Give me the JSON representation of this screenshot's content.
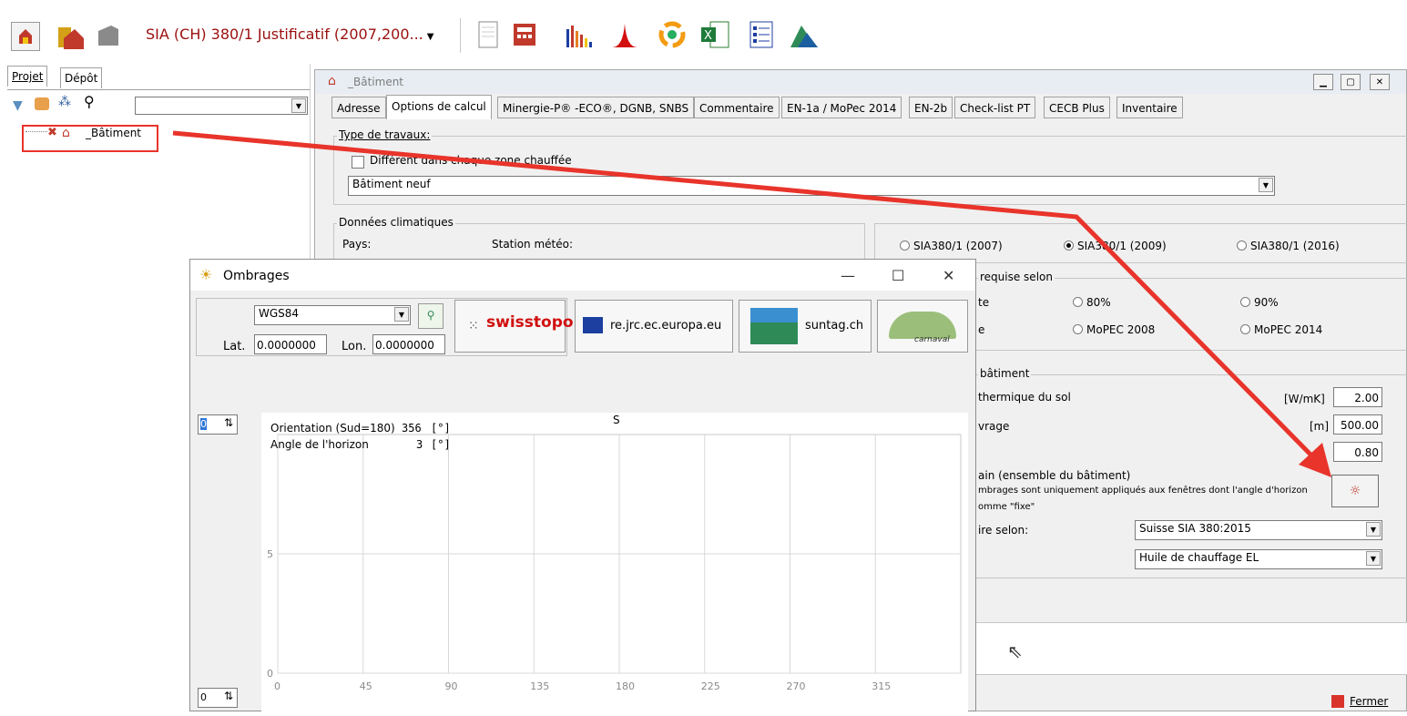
{
  "toolbar": {
    "project_select": "SIA (CH) 380/1 Justificatif (2007,200...",
    "icons": [
      "new-building-icon",
      "house-icon",
      "gray-building-icon",
      "notepad-icon",
      "calculator-icon",
      "bar-chart-icon",
      "peak-chart-icon",
      "recycle-icon",
      "excel-icon",
      "list-report-icon",
      "landscape-icon"
    ]
  },
  "left_pane": {
    "tabs": [
      "Projet",
      "Dépôt"
    ],
    "tree_item": "_Bâtiment"
  },
  "batiment": {
    "title": "_Bâtiment",
    "tabs": [
      "Adresse",
      "Options de calcul",
      "Minergie-P® -ECO®, DGNB, SNBS",
      "Commentaire",
      "EN-1a / MoPec 2014",
      "EN-2b",
      "Check-list PT",
      "CECB Plus",
      "Inventaire"
    ],
    "type_travaux": {
      "label": "Type de travaux:",
      "checkbox": "Différent dans chaque zone chauffée",
      "select": "Bâtiment neuf"
    },
    "climat": {
      "label": "Données climatiques",
      "pays": "Pays:",
      "station": "Station météo:"
    },
    "versions": [
      "SIA380/1 (2007)",
      "SIA380/1 (2009)",
      "SIA380/1 (2016)"
    ],
    "requise": {
      "label": "requise selon",
      "row1_left": "te",
      "row1_mid": "80%",
      "row1_right": "90%",
      "row2_left": "e",
      "row2_mid": "MoPEC 2008",
      "row2_right": "MoPEC 2014"
    },
    "batiment_group": {
      "label": "bâtiment",
      "row1": "thermique du sol",
      "row1_unit": "[W/mK]",
      "row1_value": "2.00",
      "row2": "vrage",
      "row2_unit": "[m]",
      "row2_value": "500.00",
      "row3_unit": "]",
      "row3_value": "0.80",
      "horizon_title": "ain (ensemble du bâtiment)",
      "horizon_note1": "mbrages sont uniquement appliqués aux fenêtres dont l'angle d'horizon",
      "horizon_note2": "omme \"fixe\"",
      "selon_label": "ire selon:",
      "selon_value": "Suisse SIA 380:2015",
      "fuel_value": "Huile de chauffage EL"
    },
    "close_label": "Fermer"
  },
  "ombrages": {
    "title": "Ombrages",
    "coord_system": "WGS84",
    "lat_label": "Lat.",
    "lat_value": "0.0000000",
    "lon_label": "Lon.",
    "lon_value": "0.0000000",
    "links": {
      "swisstopo": "swisstopo",
      "jrc": "re.jrc.ec.europa.eu",
      "suntag": "suntag.ch",
      "carnaval": "carnaval"
    },
    "spin_top": "0",
    "spin_bottom": "0",
    "info_orientation_label": "Orientation (Sud=180)",
    "info_orientation_value": "356",
    "info_orientation_unit": "[°]",
    "info_horizon_label": "Angle de l'horizon",
    "info_horizon_value": "3",
    "info_horizon_unit": "[°]"
  },
  "chart_data": {
    "type": "line",
    "title": "S",
    "xlabel": "",
    "ylabel": "",
    "x_ticks": [
      0,
      45,
      90,
      135,
      180,
      225,
      270,
      315
    ],
    "y_ticks": [
      0,
      5
    ],
    "xlim": [
      0,
      360
    ],
    "ylim": [
      0,
      10
    ],
    "grid": true,
    "series": []
  }
}
